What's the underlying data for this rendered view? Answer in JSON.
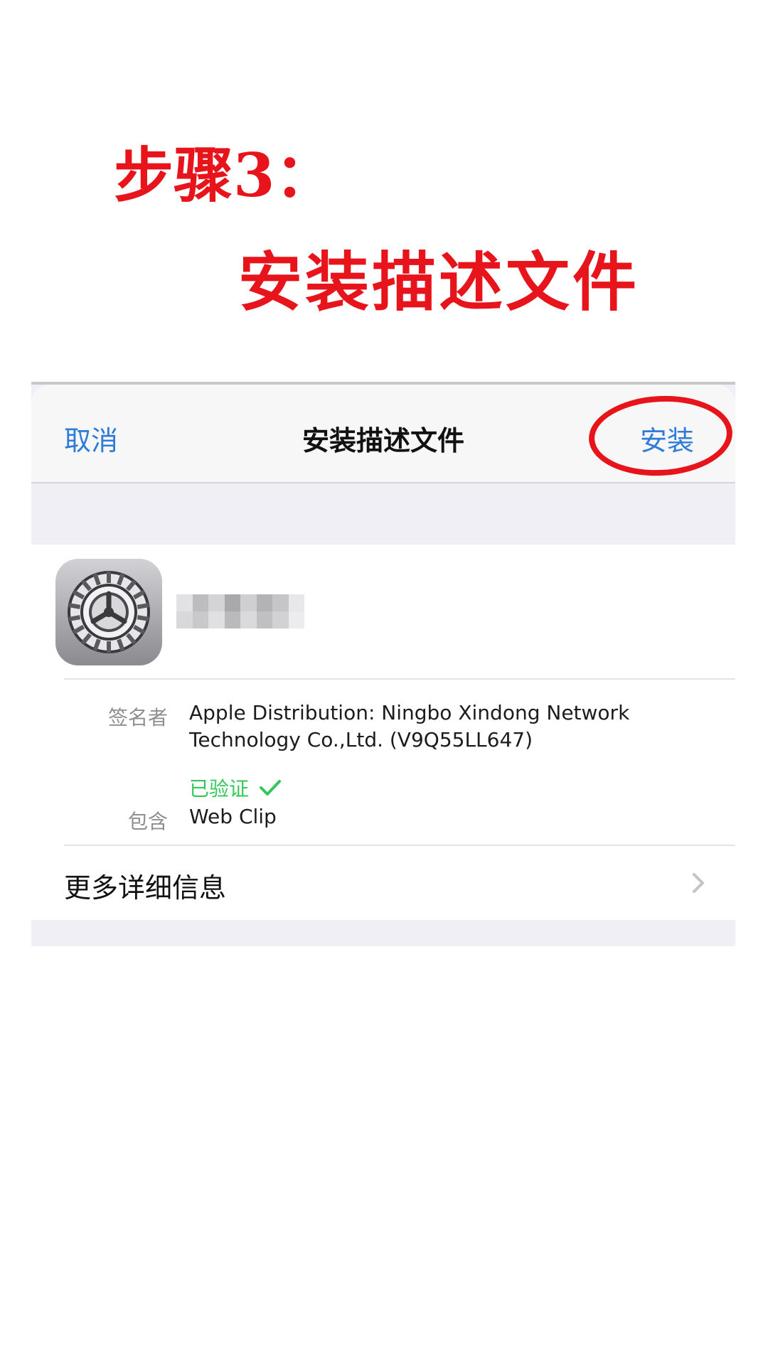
{
  "caption": {
    "step": "步骤3：",
    "subtitle": "安装描述文件"
  },
  "navbar": {
    "cancel_label": "取消",
    "title": "安装描述文件",
    "install_label": "安装"
  },
  "profile": {
    "icon": "settings-gear-icon",
    "name_redacted": true
  },
  "details": {
    "signer_label": "签名者",
    "signer_line1": "Apple Distribution: Ningbo Xindong Network",
    "signer_line2": "Technology Co.,Ltd. (V9Q55LL647)",
    "verified_label": "已验证",
    "contains_label": "包含",
    "contains_value": "Web Clip"
  },
  "more": {
    "label": "更多详细信息"
  },
  "colors": {
    "annotation_red": "#e8141c",
    "ios_blue": "#2f7bd9",
    "verified_green": "#34c759"
  }
}
